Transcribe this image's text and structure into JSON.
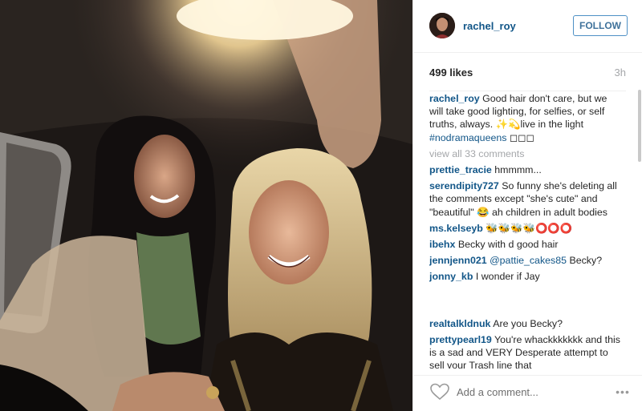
{
  "post": {
    "header": {
      "username": "rachel_roy",
      "follow_label": "FOLLOW"
    },
    "likes": "499 likes",
    "time": "3h",
    "caption": {
      "user": "rachel_roy",
      "text": "Good hair don't care, but we will take good lighting, for selfies, or self truths, always. ✨💫live in the light ",
      "hashtag": "#nodramaqueens",
      "emoji_tail": " ◻◻◻"
    },
    "view_all_label": "view all 33 comments",
    "comments": [
      {
        "user": "prettie_tracie",
        "text": "hmmmm..."
      },
      {
        "user": "serendipity727",
        "text": "So funny she's deleting all the comments except \"she's cute\" and \"beautiful\" 😂 ah children in adult bodies"
      },
      {
        "user": "ms.kelseyb",
        "text": "🐝🐝🐝🐝⭕⭕⭕"
      },
      {
        "user": "ibehx",
        "text": "Becky with d good hair"
      },
      {
        "user": "jennjenn021",
        "mention": "@pattie_cakes85",
        "text": " Becky?"
      },
      {
        "user": "jonny_kb",
        "text": "I wonder if Jay"
      },
      {
        "user": "realtalkldnuk",
        "text": "Are you Becky?"
      },
      {
        "user": "prettypearl19",
        "text": "You're whackkkkkkk and this is a sad and VERY Desperate attempt to sell your Trash line that"
      }
    ],
    "footer": {
      "add_comment_placeholder": "Add a comment...",
      "more_label": "•••"
    },
    "icons": {
      "heart": "heart-icon",
      "more": "more-options-icon"
    },
    "colors": {
      "username_blue": "#125688",
      "follow_border": "#4e90c5",
      "meta_gray": "#a5a7aa"
    }
  }
}
